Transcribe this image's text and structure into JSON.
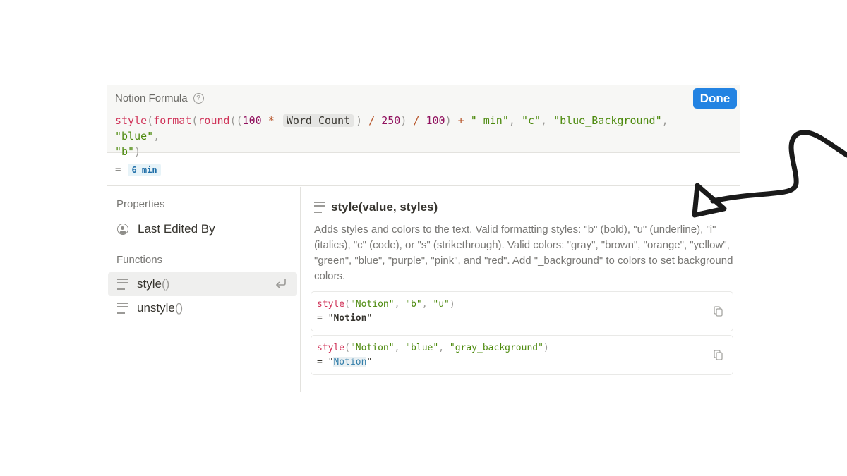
{
  "formula_editor": {
    "title": "Notion Formula",
    "help_icon": "?",
    "done_label": "Done",
    "code": {
      "t1": "style",
      "t2": "(",
      "t3": "format",
      "t4": "(",
      "t5": "round",
      "t6": "((",
      "t7": "100",
      "t8": " * ",
      "t9": "Word Count",
      "t10": ")",
      "t11": " / ",
      "t12": "250",
      "t13": ")",
      "t14": " / ",
      "t15": "100",
      "t16": ")",
      "t17": " + ",
      "t18": "\" min\"",
      "t19": ", ",
      "t20": "\"c\"",
      "t21": ", ",
      "t22": "\"blue_Background\"",
      "t23": ", ",
      "t24": "\"blue\"",
      "t25": ",",
      "t26": "\"b\"",
      "t27": ")"
    }
  },
  "result": {
    "equals": "=",
    "value": "6 min"
  },
  "sidebar": {
    "properties_label": "Properties",
    "property_items": [
      {
        "label": "Last Edited By",
        "icon": "person-circle-icon"
      }
    ],
    "functions_label": "Functions",
    "function_items": [
      {
        "name": "style",
        "parens": "()",
        "selected": true
      },
      {
        "name": "unstyle",
        "parens": "()",
        "selected": false
      }
    ]
  },
  "details": {
    "title": "style(value, styles)",
    "description": "Adds styles and colors to the text. Valid formatting styles: \"b\" (bold), \"u\" (underline), \"i\" (italics), \"c\" (code), or \"s\" (strikethrough). Valid colors: \"gray\", \"brown\", \"orange\", \"yellow\", \"green\", \"blue\", \"purple\", \"pink\", and \"red\". Add \"_background\" to colors to set background colors.",
    "examples": [
      {
        "fn": "style",
        "open": "(",
        "a1": "\"Notion\"",
        "sep1": ", ",
        "a2": "\"b\"",
        "sep2": ", ",
        "a3": "\"u\"",
        "close": ")",
        "result_prefix": "= \"",
        "result_text": "Notion",
        "result_suffix": "\""
      },
      {
        "fn": "style",
        "open": "(",
        "a1": "\"Notion\"",
        "sep1": ", ",
        "a2": "\"blue\"",
        "sep2": ", ",
        "a3": "\"gray_background\"",
        "close": ")",
        "result_prefix": "= \"",
        "result_text": "Notion",
        "result_suffix": "\""
      }
    ]
  },
  "colors": {
    "done_button": "#2383e2",
    "function_name": "#d0355a",
    "number": "#90115e",
    "string": "#4d8a0e",
    "operator": "#b7552a",
    "result_chip_text": "#1f6ea8",
    "result_chip_bg": "#e7f3f8"
  }
}
